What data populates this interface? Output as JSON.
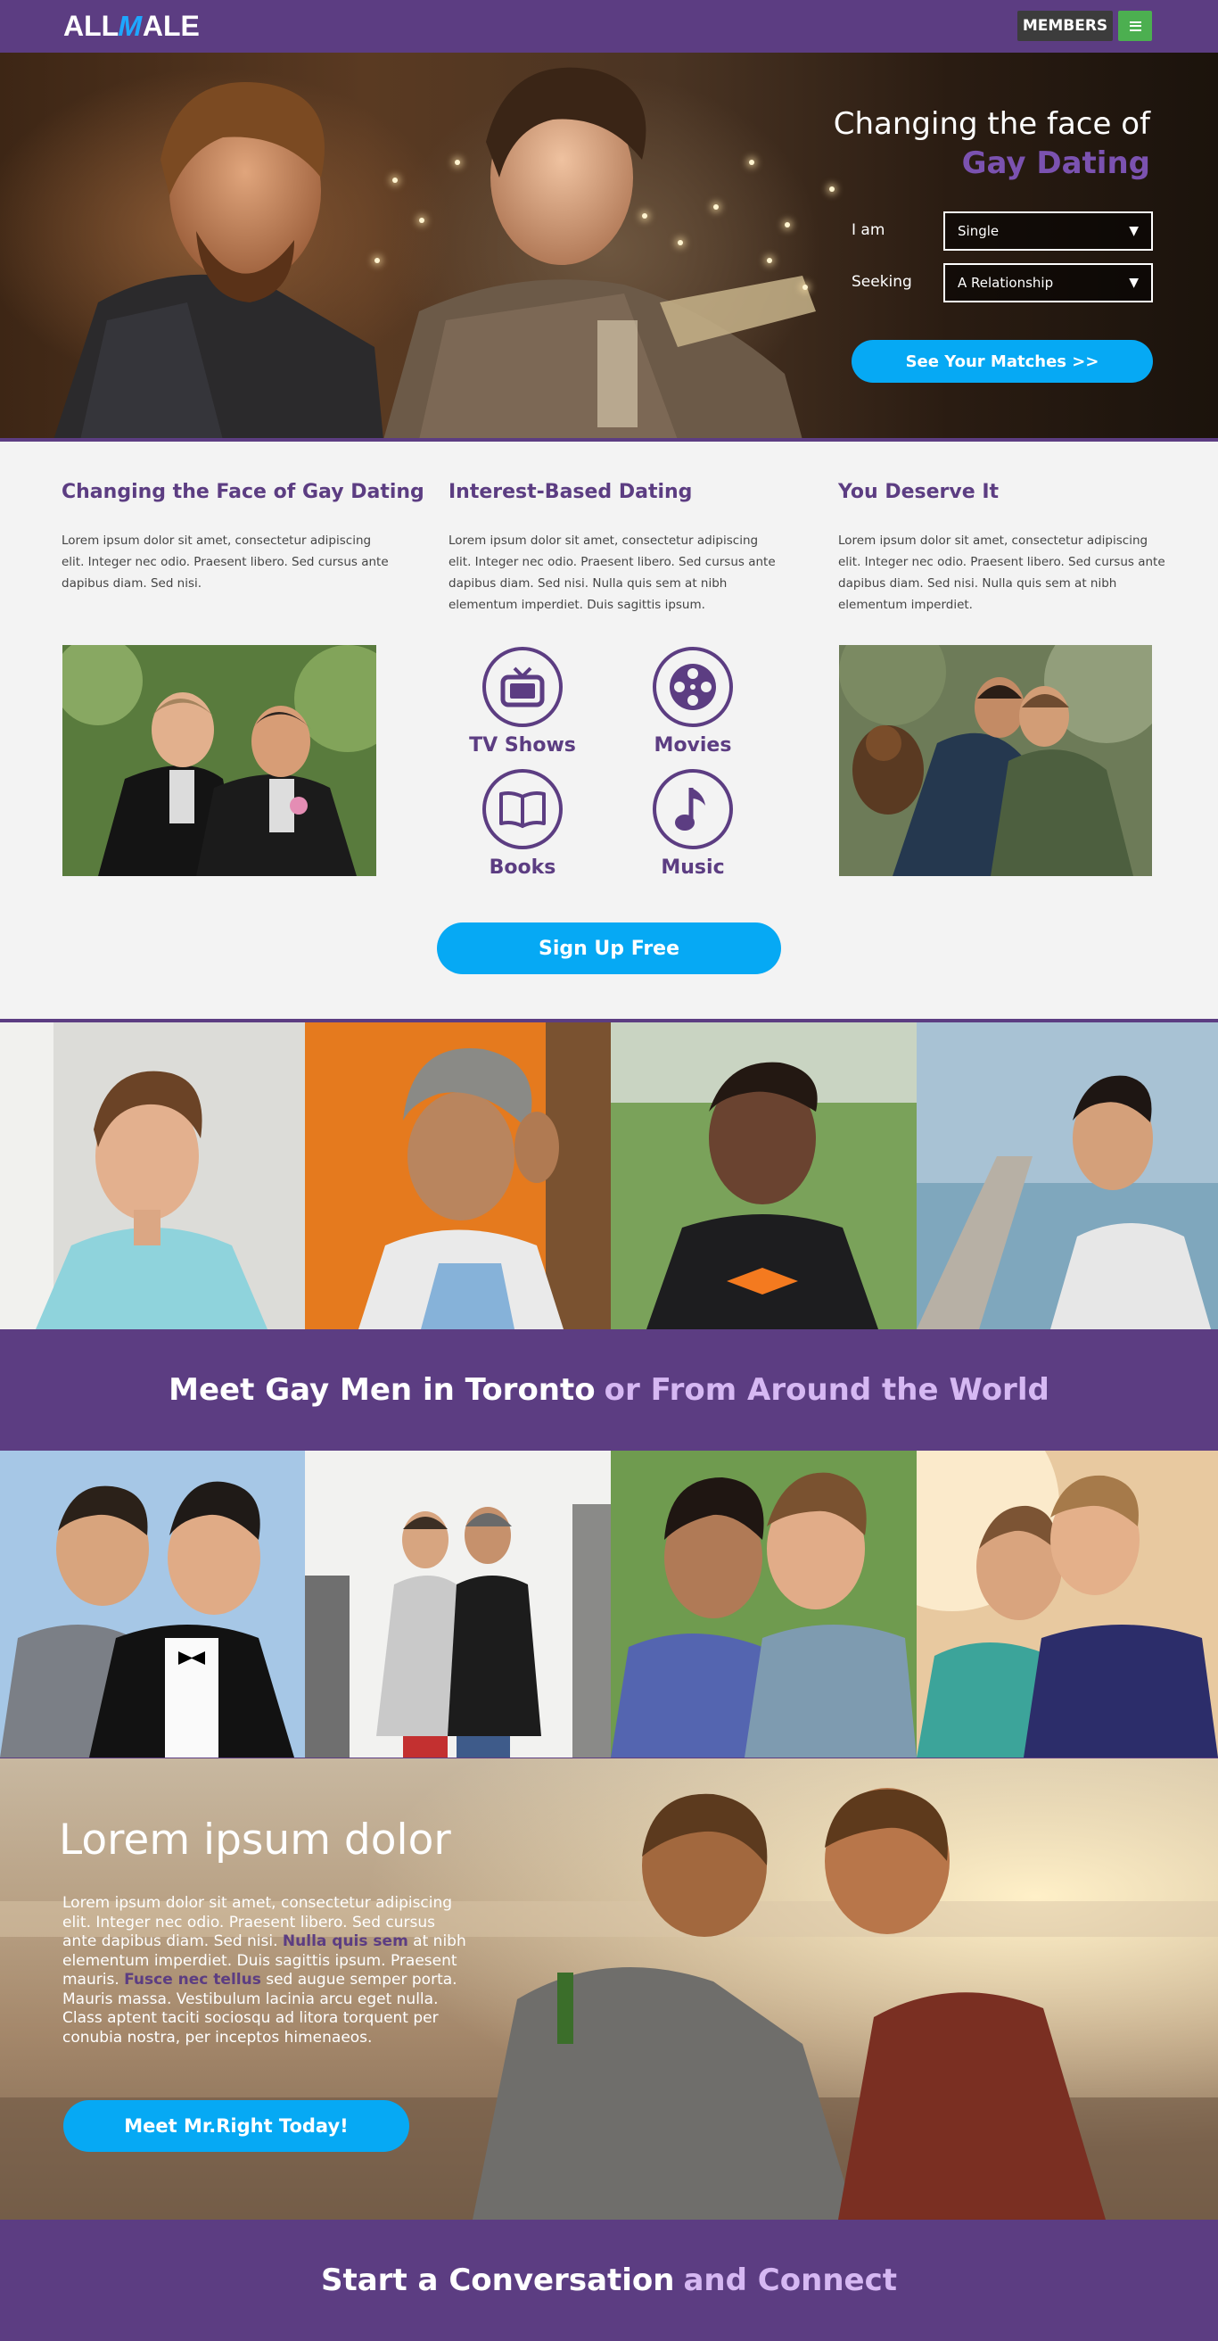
{
  "header": {
    "logo_part1": "ALL",
    "logo_m": "M",
    "logo_part2": "ALE",
    "members_label": "MEMBERS"
  },
  "hero": {
    "title_line1": "Changing the face of",
    "title_line2": "Gay Dating",
    "iam_label": "I am",
    "iam_value": "Single",
    "seeking_label": "Seeking",
    "seeking_value": "A Relationship",
    "caret": "▼",
    "cta_label": "See Your Matches >>"
  },
  "features": [
    {
      "title": "Changing the Face of Gay Dating",
      "text": "Lorem ipsum dolor sit amet, consectetur adipiscing elit. Integer nec odio. Praesent libero. Sed cursus ante dapibus diam. Sed nisi."
    },
    {
      "title": "Interest-Based Dating",
      "text": "Lorem ipsum dolor sit amet, consectetur adipiscing elit. Integer nec odio. Praesent libero. Sed cursus ante dapibus diam. Sed nisi. Nulla quis sem at nibh elementum imperdiet. Duis sagittis ipsum."
    },
    {
      "title": "You Deserve It",
      "text": "Lorem ipsum dolor sit amet, consectetur adipiscing elit. Integer nec odio. Praesent libero. Sed cursus ante dapibus diam. Sed nisi. Nulla quis sem at nibh elementum imperdiet."
    }
  ],
  "interests": [
    {
      "label": "TV Shows",
      "icon": "tv-icon"
    },
    {
      "label": "Movies",
      "icon": "film-reel-icon"
    },
    {
      "label": "Books",
      "icon": "book-icon"
    },
    {
      "label": "Music",
      "icon": "music-note-icon"
    }
  ],
  "signup_label": "Sign Up Free",
  "banner1": {
    "main": "Meet Gay Men in Toronto",
    "accent": "or From Around the World"
  },
  "beach": {
    "title": "Lorem ipsum dolor",
    "text_1": "Lorem ipsum dolor sit amet, consectetur adipiscing elit. Integer nec odio. Praesent libero. Sed cursus ante dapibus diam. Sed nisi. ",
    "link_1": "Nulla quis sem",
    "text_2": " at nibh elementum imperdiet. Duis sagittis ipsum. Praesent mauris. ",
    "link_2": "Fusce nec tellus",
    "text_3": " sed augue semper porta. Mauris massa. Vestibulum lacinia arcu eget nulla. Class aptent taciti sociosqu ad litora torquent per conubia nostra, per inceptos himenaeos.",
    "cta_label": "Meet Mr.Right Today!"
  },
  "banner2": {
    "main": "Start a Conversation",
    "accent": "and Connect"
  },
  "colors": {
    "brand_purple": "#5c3d82",
    "accent_blue": "#06a9f4",
    "menu_green": "#4caf50",
    "light_purple": "#d6b8f3"
  }
}
